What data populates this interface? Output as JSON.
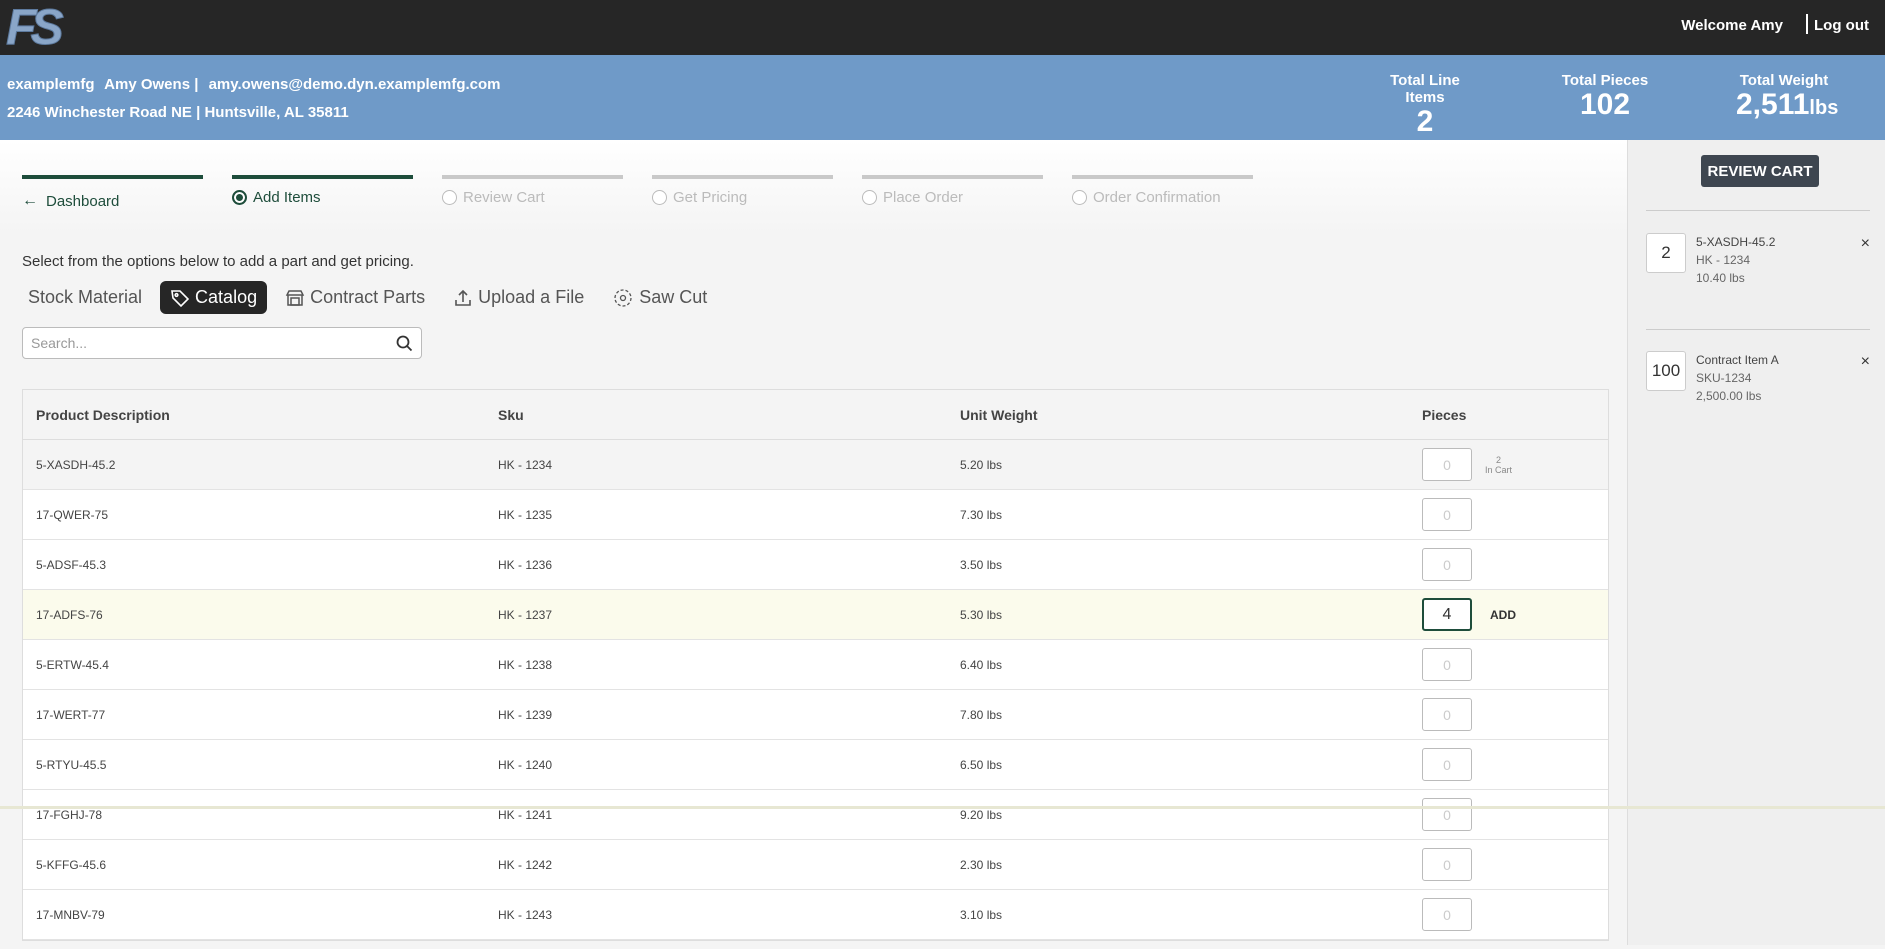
{
  "header": {
    "logo_text": "FS",
    "welcome": "Welcome Amy",
    "logout": "Log out"
  },
  "customer": {
    "company": "examplemfg",
    "name": "Amy Owens |",
    "email": "amy.owens@demo.dyn.examplemfg.com",
    "address": "2246 Winchester Road NE | Huntsville, AL 35811"
  },
  "stats": {
    "line_items_label": "Total Line Items",
    "line_items_value": "2",
    "pieces_label": "Total Pieces",
    "pieces_value": "102",
    "weight_label": "Total Weight",
    "weight_value": "2,511",
    "weight_unit": "lbs"
  },
  "steps": [
    {
      "label": "Dashboard",
      "state": "done"
    },
    {
      "label": "Add Items",
      "state": "active"
    },
    {
      "label": "Review Cart",
      "state": "pending"
    },
    {
      "label": "Get Pricing",
      "state": "pending"
    },
    {
      "label": "Place Order",
      "state": "pending"
    },
    {
      "label": "Order Confirmation",
      "state": "pending"
    }
  ],
  "instructions": "Select from the options below to add a part and get pricing.",
  "tabs": [
    {
      "label": "Stock Material",
      "icon": "none"
    },
    {
      "label": "Catalog",
      "icon": "tag-icon",
      "active": true
    },
    {
      "label": "Contract Parts",
      "icon": "store-icon"
    },
    {
      "label": "Upload a File",
      "icon": "upload-icon"
    },
    {
      "label": "Saw Cut",
      "icon": "saw-blade-icon"
    }
  ],
  "search": {
    "placeholder": "Search..."
  },
  "table": {
    "headers": [
      "Product Description",
      "Sku",
      "Unit Weight",
      "Pieces"
    ],
    "rows": [
      {
        "desc": "5-XASDH-45.2",
        "sku": "HK - 1234",
        "weight": "5.20 lbs",
        "qty": "",
        "qty_placeholder": "0",
        "incart_count": "2",
        "incart_label": "In Cart"
      },
      {
        "desc": "17-QWER-75",
        "sku": "HK - 1235",
        "weight": "7.30 lbs",
        "qty": "",
        "qty_placeholder": "0"
      },
      {
        "desc": "5-ADSF-45.3",
        "sku": "HK - 1236",
        "weight": "3.50 lbs",
        "qty": "",
        "qty_placeholder": "0"
      },
      {
        "desc": "17-ADFS-76",
        "sku": "HK - 1237",
        "weight": "5.30 lbs",
        "qty": "4",
        "qty_placeholder": "0",
        "add_label": "ADD"
      },
      {
        "desc": "5-ERTW-45.4",
        "sku": "HK - 1238",
        "weight": "6.40 lbs",
        "qty": "",
        "qty_placeholder": "0"
      },
      {
        "desc": "17-WERT-77",
        "sku": "HK - 1239",
        "weight": "7.80 lbs",
        "qty": "",
        "qty_placeholder": "0"
      },
      {
        "desc": "5-RTYU-45.5",
        "sku": "HK - 1240",
        "weight": "6.50 lbs",
        "qty": "",
        "qty_placeholder": "0"
      },
      {
        "desc": "17-FGHJ-78",
        "sku": "HK - 1241",
        "weight": "9.20 lbs",
        "qty": "",
        "qty_placeholder": "0"
      },
      {
        "desc": "5-KFFG-45.6",
        "sku": "HK - 1242",
        "weight": "2.30 lbs",
        "qty": "",
        "qty_placeholder": "0"
      },
      {
        "desc": "17-MNBV-79",
        "sku": "HK - 1243",
        "weight": "3.10 lbs",
        "qty": "",
        "qty_placeholder": "0"
      }
    ]
  },
  "cart": {
    "review_label": "REVIEW CART",
    "items": [
      {
        "qty": "2",
        "name": "5-XASDH-45.2",
        "sku": "HK - 1234",
        "weight": "10.40 lbs",
        "remove": "×"
      },
      {
        "qty": "100",
        "name": "Contract Item A",
        "sku": "SKU-1234",
        "weight": "2,500.00 lbs",
        "remove": "×"
      }
    ]
  },
  "colors": {
    "topbar": "#262626",
    "customer_bar": "#6f9ac8",
    "step_active": "#1e4d3b",
    "review_button": "#3e4650"
  }
}
